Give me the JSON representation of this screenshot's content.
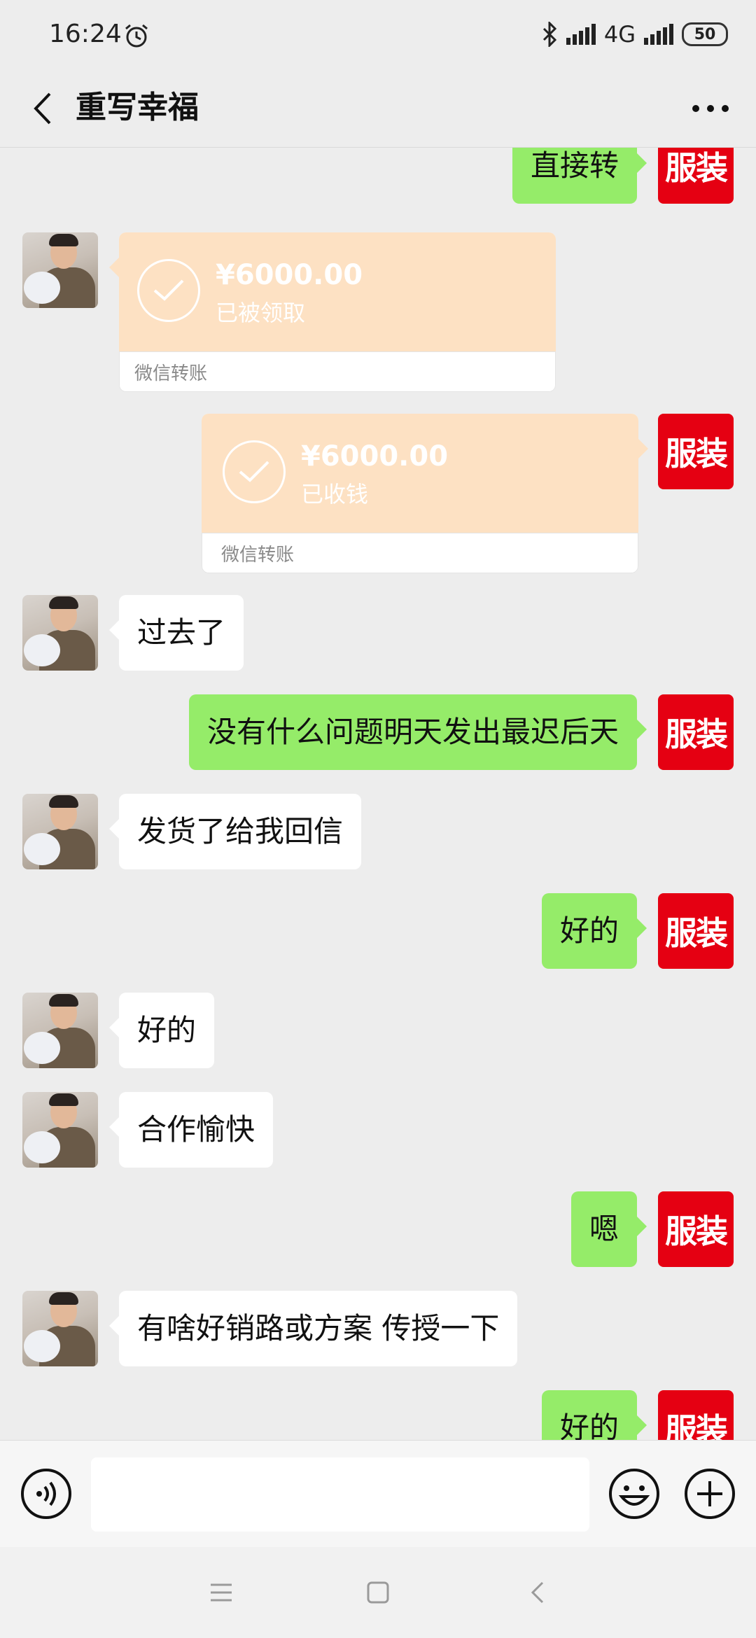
{
  "status_bar": {
    "time": "16:24",
    "network": "4G",
    "battery": "50",
    "icons": [
      "alarm-icon",
      "bluetooth-icon",
      "signal-icon",
      "signal-icon",
      "battery-icon"
    ]
  },
  "header": {
    "title": "重写幸福",
    "back_icon": "chevron-left-icon",
    "more_icon": "more-icon"
  },
  "colors": {
    "background": "#ededed",
    "my_bubble": "#95ec69",
    "friend_bubble": "#ffffff",
    "transfer_card": "#fde1c3",
    "my_avatar": "#e50012"
  },
  "messages": [
    {
      "side": "right",
      "type": "text",
      "text": "直接转"
    },
    {
      "side": "left",
      "type": "transfer",
      "amount": "¥6000.00",
      "status": "已被领取",
      "label": "微信转账"
    },
    {
      "side": "right",
      "type": "transfer",
      "amount": "¥6000.00",
      "status": "已收钱",
      "label": "微信转账"
    },
    {
      "side": "left",
      "type": "text",
      "text": "过去了"
    },
    {
      "side": "right",
      "type": "text",
      "text": "没有什么问题明天发出最迟后天"
    },
    {
      "side": "left",
      "type": "text",
      "text": "发货了给我回信"
    },
    {
      "side": "right",
      "type": "text",
      "text": "好的"
    },
    {
      "side": "left",
      "type": "text",
      "text": "好的"
    },
    {
      "side": "left",
      "type": "text",
      "text": "合作愉快"
    },
    {
      "side": "right",
      "type": "text",
      "text": "嗯"
    },
    {
      "side": "left",
      "type": "text",
      "text": "有啥好销路或方案 传授一下"
    },
    {
      "side": "right",
      "type": "text",
      "text": "好的"
    }
  ],
  "my_avatar_text": "服装",
  "input_bar": {
    "value": "",
    "voice_icon": "voice-icon",
    "emoji_icon": "emoji-icon",
    "plus_icon": "plus-icon"
  },
  "nav_bar": {
    "icons": [
      "menu-icon",
      "home-icon",
      "back-icon"
    ]
  }
}
